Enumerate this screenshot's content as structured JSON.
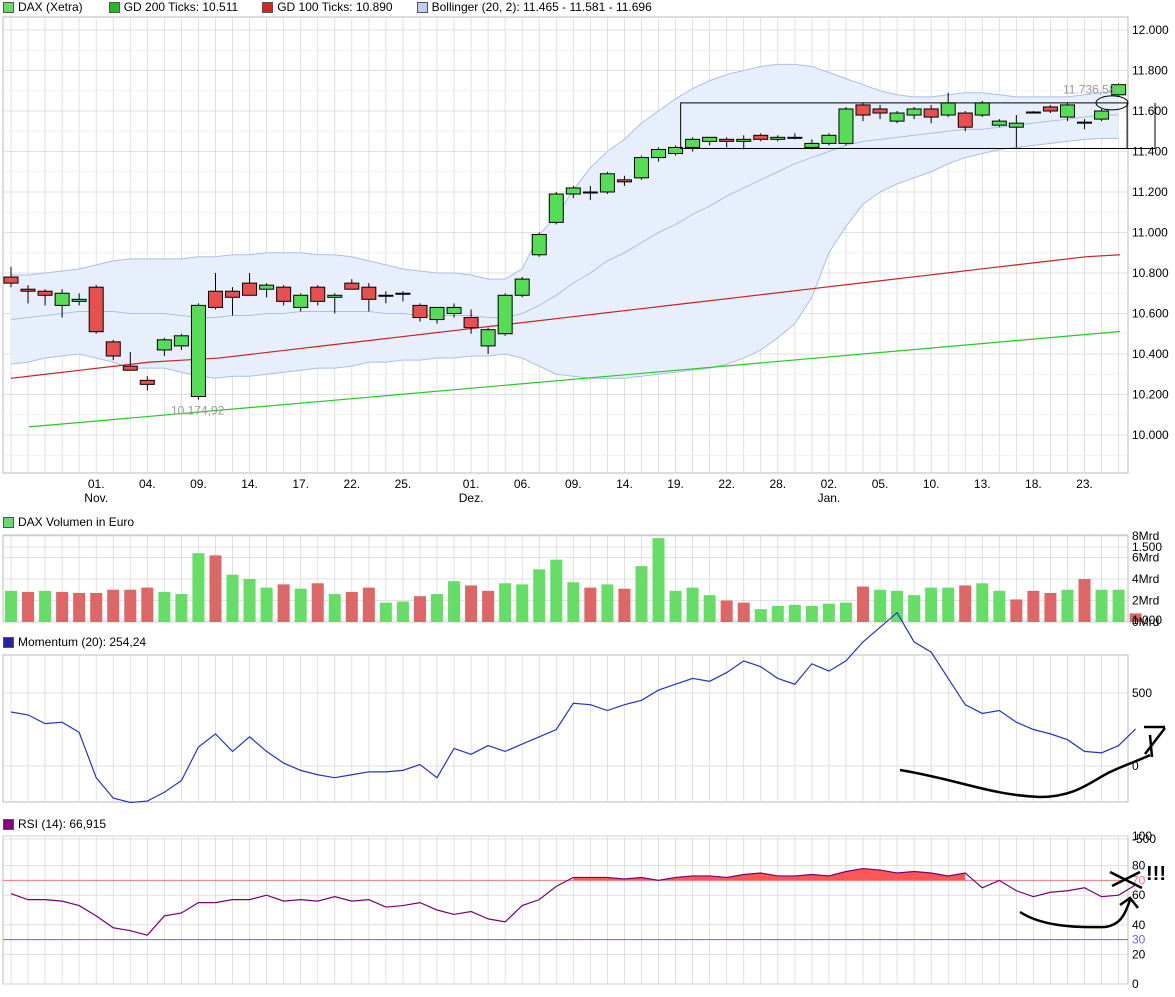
{
  "legend_main": [
    {
      "label": "DAX (Xetra)",
      "color": "#66dd66"
    },
    {
      "label": "GD 200 Ticks: 10.511",
      "color": "#22bb22"
    },
    {
      "label": "GD 100 Ticks: 10.890",
      "color": "#dd2222"
    },
    {
      "label": "Bollinger (20, 2): 11.465 - 11.581 - 11.696",
      "color": "#bcd0f2"
    }
  ],
  "legend_volume": {
    "label": "DAX Volumen in Euro",
    "color": "#66dd66"
  },
  "legend_momentum": {
    "label": "Momentum (20): 254,24",
    "color": "#2222aa"
  },
  "legend_rsi": {
    "label": "RSI (14): 66,915",
    "color": "#880088"
  },
  "annotations": {
    "high": "11.736,58",
    "low": "10.174,92",
    "rsi_70": "70",
    "rsi_30": "30",
    "exclaim": "!!!"
  },
  "colors": {
    "up": "#55dd55",
    "down": "#e85050",
    "bollinger_fill": "#e8effc",
    "bollinger_line": "#a9bfe8",
    "ma200": "#22cc22",
    "ma100": "#cc2222",
    "momentum": "#2233cc",
    "rsi": "#770077",
    "rsi_fill": "#ff5555",
    "grid": "#d9d9d9",
    "vol_up": "#66dd66",
    "vol_down": "#dd6666"
  },
  "chart_data": [
    {
      "type": "candlestick",
      "title": "DAX (Xetra)",
      "ylim": [
        9850,
        12050
      ],
      "yticks": [
        "10.000",
        "10.200",
        "10.400",
        "10.600",
        "10.800",
        "11.000",
        "11.200",
        "11.400",
        "11.600",
        "11.800",
        "12.000"
      ],
      "ytick_values": [
        10000,
        10200,
        10400,
        10600,
        10800,
        11000,
        11200,
        11400,
        11600,
        11800,
        12000
      ],
      "xlabels": [
        {
          "i": 5,
          "t": "01.",
          "sub": "Nov."
        },
        {
          "i": 8,
          "t": "04."
        },
        {
          "i": 11,
          "t": "09."
        },
        {
          "i": 14,
          "t": "14."
        },
        {
          "i": 17,
          "t": "17."
        },
        {
          "i": 20,
          "t": "22."
        },
        {
          "i": 23,
          "t": "25."
        },
        {
          "i": 27,
          "t": "01.",
          "sub": "Dez."
        },
        {
          "i": 30,
          "t": "06."
        },
        {
          "i": 33,
          "t": "09."
        },
        {
          "i": 36,
          "t": "14."
        },
        {
          "i": 39,
          "t": "19."
        },
        {
          "i": 42,
          "t": "22."
        },
        {
          "i": 45,
          "t": "28."
        },
        {
          "i": 48,
          "t": "02.",
          "sub": "Jan."
        },
        {
          "i": 51,
          "t": "05."
        },
        {
          "i": 54,
          "t": "10."
        },
        {
          "i": 57,
          "t": "13."
        },
        {
          "i": 60,
          "t": "18."
        },
        {
          "i": 63,
          "t": "23."
        }
      ],
      "candles": [
        {
          "o": 10780,
          "h": 10830,
          "l": 10730,
          "c": 10750
        },
        {
          "o": 10720,
          "h": 10740,
          "l": 10650,
          "c": 10710
        },
        {
          "o": 10710,
          "h": 10720,
          "l": 10640,
          "c": 10690
        },
        {
          "o": 10640,
          "h": 10720,
          "l": 10580,
          "c": 10700
        },
        {
          "o": 10660,
          "h": 10700,
          "l": 10640,
          "c": 10670
        },
        {
          "o": 10730,
          "h": 10740,
          "l": 10500,
          "c": 10510
        },
        {
          "o": 10460,
          "h": 10470,
          "l": 10370,
          "c": 10390
        },
        {
          "o": 10340,
          "h": 10410,
          "l": 10320,
          "c": 10320
        },
        {
          "o": 10270,
          "h": 10290,
          "l": 10220,
          "c": 10250
        },
        {
          "o": 10420,
          "h": 10480,
          "l": 10390,
          "c": 10470
        },
        {
          "o": 10440,
          "h": 10500,
          "l": 10420,
          "c": 10490
        },
        {
          "o": 10190,
          "h": 10650,
          "l": 10175,
          "c": 10640
        },
        {
          "o": 10710,
          "h": 10800,
          "l": 10620,
          "c": 10630
        },
        {
          "o": 10710,
          "h": 10730,
          "l": 10590,
          "c": 10680
        },
        {
          "o": 10750,
          "h": 10800,
          "l": 10690,
          "c": 10690
        },
        {
          "o": 10720,
          "h": 10750,
          "l": 10680,
          "c": 10740
        },
        {
          "o": 10730,
          "h": 10740,
          "l": 10640,
          "c": 10660
        },
        {
          "o": 10630,
          "h": 10700,
          "l": 10610,
          "c": 10690
        },
        {
          "o": 10730,
          "h": 10740,
          "l": 10640,
          "c": 10660
        },
        {
          "o": 10680,
          "h": 10700,
          "l": 10600,
          "c": 10690
        },
        {
          "o": 10750,
          "h": 10770,
          "l": 10720,
          "c": 10720
        },
        {
          "o": 10730,
          "h": 10750,
          "l": 10610,
          "c": 10670
        },
        {
          "o": 10690,
          "h": 10710,
          "l": 10650,
          "c": 10690
        },
        {
          "o": 10700,
          "h": 10710,
          "l": 10660,
          "c": 10700
        },
        {
          "o": 10640,
          "h": 10650,
          "l": 10560,
          "c": 10580
        },
        {
          "o": 10570,
          "h": 10630,
          "l": 10550,
          "c": 10630
        },
        {
          "o": 10600,
          "h": 10650,
          "l": 10580,
          "c": 10630
        },
        {
          "o": 10580,
          "h": 10620,
          "l": 10500,
          "c": 10530
        },
        {
          "o": 10440,
          "h": 10530,
          "l": 10400,
          "c": 10520
        },
        {
          "o": 10500,
          "h": 10700,
          "l": 10490,
          "c": 10690
        },
        {
          "o": 10690,
          "h": 10780,
          "l": 10680,
          "c": 10770
        },
        {
          "o": 10890,
          "h": 11000,
          "l": 10880,
          "c": 10990
        },
        {
          "o": 11050,
          "h": 11200,
          "l": 11040,
          "c": 11190
        },
        {
          "o": 11190,
          "h": 11230,
          "l": 11170,
          "c": 11220
        },
        {
          "o": 11200,
          "h": 11230,
          "l": 11160,
          "c": 11200
        },
        {
          "o": 11200,
          "h": 11300,
          "l": 11190,
          "c": 11290
        },
        {
          "o": 11260,
          "h": 11280,
          "l": 11230,
          "c": 11250
        },
        {
          "o": 11270,
          "h": 11380,
          "l": 11260,
          "c": 11370
        },
        {
          "o": 11370,
          "h": 11420,
          "l": 11350,
          "c": 11410
        },
        {
          "o": 11390,
          "h": 11430,
          "l": 11380,
          "c": 11420
        },
        {
          "o": 11420,
          "h": 11470,
          "l": 11400,
          "c": 11460
        },
        {
          "o": 11450,
          "h": 11470,
          "l": 11430,
          "c": 11470
        },
        {
          "o": 11460,
          "h": 11470,
          "l": 11420,
          "c": 11450
        },
        {
          "o": 11450,
          "h": 11480,
          "l": 11410,
          "c": 11460
        },
        {
          "o": 11480,
          "h": 11490,
          "l": 11450,
          "c": 11460
        },
        {
          "o": 11460,
          "h": 11480,
          "l": 11450,
          "c": 11470
        },
        {
          "o": 11470,
          "h": 11490,
          "l": 11460,
          "c": 11470
        },
        {
          "o": 11420,
          "h": 11460,
          "l": 11410,
          "c": 11440
        },
        {
          "o": 11440,
          "h": 11490,
          "l": 11430,
          "c": 11480
        },
        {
          "o": 11440,
          "h": 11620,
          "l": 11430,
          "c": 11610
        },
        {
          "o": 11630,
          "h": 11640,
          "l": 11550,
          "c": 11580
        },
        {
          "o": 11610,
          "h": 11630,
          "l": 11560,
          "c": 11590
        },
        {
          "o": 11550,
          "h": 11600,
          "l": 11540,
          "c": 11590
        },
        {
          "o": 11580,
          "h": 11620,
          "l": 11560,
          "c": 11610
        },
        {
          "o": 11610,
          "h": 11630,
          "l": 11540,
          "c": 11570
        },
        {
          "o": 11580,
          "h": 11690,
          "l": 11570,
          "c": 11640
        },
        {
          "o": 11590,
          "h": 11600,
          "l": 11500,
          "c": 11520
        },
        {
          "o": 11580,
          "h": 11650,
          "l": 11570,
          "c": 11640
        },
        {
          "o": 11530,
          "h": 11560,
          "l": 11520,
          "c": 11550
        },
        {
          "o": 11520,
          "h": 11580,
          "l": 11420,
          "c": 11540
        },
        {
          "o": 11590,
          "h": 11600,
          "l": 11590,
          "c": 11595
        },
        {
          "o": 11620,
          "h": 11630,
          "l": 11590,
          "c": 11600
        },
        {
          "o": 11570,
          "h": 11640,
          "l": 11550,
          "c": 11630
        },
        {
          "o": 11540,
          "h": 11560,
          "l": 11510,
          "c": 11545
        },
        {
          "o": 11560,
          "h": 11610,
          "l": 11550,
          "c": 11600
        },
        {
          "o": 11680,
          "h": 11737,
          "l": 11670,
          "c": 11730
        }
      ],
      "ma200_endpoints": {
        "start": 10040,
        "end": 10511
      },
      "ma100_points": [
        10280,
        10300,
        10320,
        10340,
        10360,
        10370,
        10380,
        10400,
        10420,
        10440,
        10460,
        10480,
        10500,
        10520,
        10540,
        10560,
        10580,
        10600,
        10620,
        10640,
        10660,
        10680,
        10700,
        10720,
        10740,
        10760,
        10780,
        10800,
        10820,
        10840,
        10860,
        10880,
        10890
      ],
      "bollinger": {
        "upper": [
          10790,
          10790,
          10800,
          10810,
          10820,
          10840,
          10860,
          10870,
          10870,
          10870,
          10870,
          10880,
          10880,
          10890,
          10890,
          10900,
          10900,
          10900,
          10890,
          10890,
          10880,
          10860,
          10840,
          10820,
          10810,
          10800,
          10800,
          10790,
          10770,
          10770,
          10820,
          10990,
          11080,
          11210,
          11320,
          11400,
          11460,
          11540,
          11600,
          11660,
          11710,
          11750,
          11780,
          11800,
          11820,
          11830,
          11830,
          11820,
          11790,
          11760,
          11730,
          11700,
          11680,
          11670,
          11670,
          11680,
          11690,
          11690,
          11680,
          11670,
          11670,
          11670,
          11670,
          11680,
          11690,
          11696
        ],
        "middle": [
          10570,
          10580,
          10590,
          10600,
          10610,
          10610,
          10610,
          10600,
          10600,
          10600,
          10590,
          10580,
          10580,
          10590,
          10590,
          10600,
          10600,
          10610,
          10610,
          10610,
          10610,
          10610,
          10600,
          10600,
          10590,
          10590,
          10590,
          10590,
          10580,
          10580,
          10600,
          10640,
          10690,
          10750,
          10800,
          10860,
          10900,
          10950,
          11000,
          11040,
          11090,
          11130,
          11180,
          11220,
          11260,
          11300,
          11340,
          11370,
          11400,
          11430,
          11450,
          11460,
          11470,
          11480,
          11490,
          11500,
          11510,
          11510,
          11520,
          11530,
          11540,
          11550,
          11560,
          11570,
          11580,
          11581
        ],
        "lower": [
          10350,
          10360,
          10380,
          10390,
          10400,
          10380,
          10360,
          10330,
          10330,
          10330,
          10310,
          10290,
          10280,
          10290,
          10290,
          10300,
          10310,
          10320,
          10330,
          10330,
          10340,
          10360,
          10360,
          10370,
          10370,
          10380,
          10380,
          10390,
          10390,
          10400,
          10380,
          10340,
          10300,
          10290,
          10280,
          10280,
          10280,
          10290,
          10300,
          10310,
          10320,
          10330,
          10350,
          10380,
          10420,
          10480,
          10550,
          10680,
          10900,
          11030,
          11140,
          11200,
          11240,
          11270,
          11300,
          11340,
          11370,
          11390,
          11410,
          11420,
          11430,
          11440,
          11450,
          11460,
          11465,
          11465
        ]
      },
      "box": {
        "x0": 39.3,
        "x1": 65.5,
        "y0": 11415,
        "y1": 11640
      }
    },
    {
      "type": "bar",
      "title": "DAX Volumen in Euro",
      "ylim": [
        0,
        8
      ],
      "yticks": [
        "0Mrd",
        "2Mrd",
        "4Mrd",
        "6Mrd",
        "8Mrd"
      ],
      "ytick_values": [
        0,
        2,
        4,
        6,
        8
      ],
      "values": [
        2.9,
        2.8,
        2.9,
        2.8,
        2.7,
        2.7,
        3.0,
        3.0,
        3.2,
        2.8,
        2.6,
        6.4,
        6.2,
        4.4,
        4.0,
        3.2,
        3.5,
        3.1,
        3.6,
        2.6,
        2.8,
        3.2,
        1.8,
        1.9,
        2.4,
        2.6,
        3.8,
        3.4,
        2.9,
        3.6,
        3.5,
        4.9,
        5.8,
        3.7,
        3.2,
        3.5,
        3.1,
        5.2,
        7.8,
        2.9,
        3.2,
        2.5,
        2.0,
        1.8,
        1.2,
        1.5,
        1.6,
        1.5,
        1.7,
        1.8,
        3.3,
        3.0,
        2.9,
        2.5,
        3.2,
        3.2,
        3.4,
        3.6,
        2.9,
        2.1,
        2.9,
        2.7,
        3.0,
        4.0,
        3.0,
        3.0,
        0.8
      ],
      "up": [
        true,
        false,
        true,
        false,
        false,
        false,
        false,
        false,
        false,
        true,
        true,
        true,
        false,
        true,
        true,
        true,
        false,
        true,
        false,
        true,
        false,
        false,
        true,
        true,
        false,
        true,
        true,
        false,
        true,
        true,
        true,
        true,
        true,
        true,
        false,
        true,
        false,
        true,
        true,
        true,
        true,
        true,
        false,
        true,
        false,
        true,
        true,
        false,
        true,
        true,
        false,
        true,
        true,
        true,
        false,
        true,
        false,
        true,
        true,
        false,
        false,
        false,
        true,
        true,
        true,
        true,
        true
      ],
      "col_up": [
        true,
        false,
        true,
        false,
        false,
        false,
        false,
        false,
        false,
        true,
        true,
        true,
        false,
        true,
        true,
        true,
        false,
        true,
        false,
        true,
        false,
        false,
        true,
        true,
        false,
        true,
        true,
        false,
        false,
        true,
        true,
        true,
        true,
        true,
        false,
        true,
        false,
        true,
        true,
        true,
        true,
        true,
        false,
        false,
        true,
        true,
        true,
        true,
        true,
        true,
        false,
        true,
        true,
        true,
        true,
        true,
        false,
        true,
        true,
        false,
        false,
        false,
        true,
        false,
        true,
        true
      ]
    },
    {
      "type": "line",
      "title": "Momentum (20): 254,24",
      "ylim": [
        -500,
        1500
      ],
      "yticks": [
        "-500",
        "0",
        "500",
        "1.000",
        "1.500"
      ],
      "ytick_values": [
        -500,
        0,
        500,
        1000,
        1500
      ],
      "values": [
        370,
        350,
        290,
        300,
        230,
        -80,
        -220,
        -250,
        -240,
        -180,
        -100,
        130,
        220,
        100,
        200,
        100,
        20,
        -30,
        -60,
        -80,
        -60,
        -40,
        -40,
        -30,
        10,
        -80,
        120,
        80,
        140,
        100,
        150,
        200,
        250,
        430,
        420,
        380,
        420,
        450,
        520,
        560,
        600,
        580,
        640,
        720,
        680,
        600,
        560,
        700,
        650,
        720,
        850,
        950,
        1050,
        850,
        780,
        600,
        420,
        360,
        380,
        300,
        250,
        220,
        180,
        100,
        90,
        140,
        254
      ]
    },
    {
      "type": "line",
      "title": "RSI (14): 66,915",
      "ylim": [
        0,
        100
      ],
      "yticks": [
        "0",
        "20",
        "40",
        "60",
        "80",
        "100"
      ],
      "ytick_values": [
        0,
        20,
        40,
        60,
        80,
        100
      ],
      "ref_lines": [
        70,
        30
      ],
      "values": [
        61,
        57,
        57,
        56,
        53,
        46,
        38,
        36,
        33,
        46,
        48,
        55,
        55,
        57,
        57,
        60,
        56,
        57,
        56,
        59,
        56,
        57,
        52,
        53,
        55,
        50,
        47,
        49,
        44,
        42,
        53,
        57,
        66,
        72,
        72,
        72,
        71,
        72,
        70,
        72,
        73,
        73,
        72,
        74,
        75,
        73,
        73,
        74,
        73,
        76,
        78,
        77,
        75,
        76,
        75,
        73,
        75,
        65,
        70,
        63,
        59,
        62,
        63,
        65,
        59,
        60,
        67
      ]
    }
  ]
}
